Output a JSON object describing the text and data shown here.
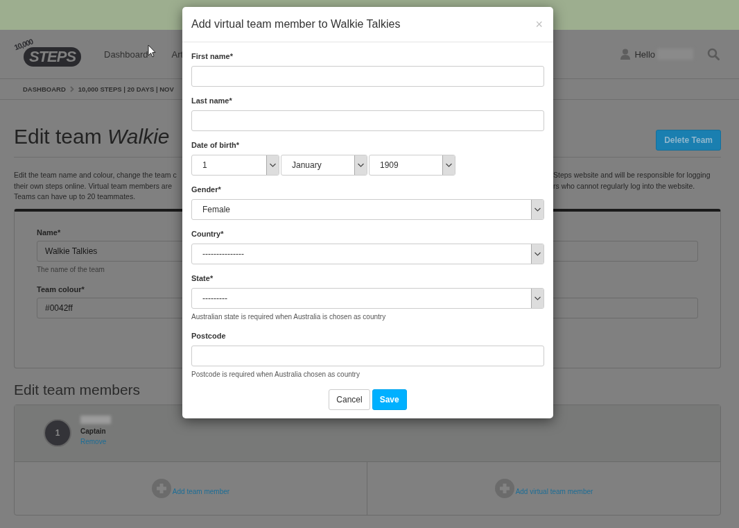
{
  "header": {
    "logo": {
      "number": "10,000",
      "word": "STEPS"
    },
    "nav": [
      {
        "label": "Dashboard"
      },
      {
        "label": "Art"
      }
    ],
    "greeting": "Hello"
  },
  "breadcrumb": [
    "DASHBOARD",
    "10,000 STEPS | 20 DAYS | NOV"
  ],
  "page": {
    "title": "Edit team *Walkie*",
    "delete_button": "Delete Team",
    "description": [
      {
        "left": "Edit the team name and colour, change the team c",
        "right": "Steps website and will be responsible for logging"
      },
      {
        "left": "their own steps online. Virtual team members are",
        "right": "rs who cannot regularly log into the website."
      },
      {
        "left": "Teams can have up to 20 teammates."
      }
    ]
  },
  "team_form": {
    "fields": [
      {
        "label": "Name*",
        "value": "Walkie Talkies",
        "help": "The name of the team"
      },
      {
        "label": "Team colour*",
        "value": "#0042ff"
      }
    ]
  },
  "members": {
    "heading": "Edit team members",
    "list": [
      {
        "number": "1",
        "role": "Captain",
        "action": "Remove"
      }
    ],
    "add_actions": [
      "Add team member",
      "Add virtual team member"
    ]
  },
  "modal": {
    "title": "Add virtual team member to Walkie Talkies",
    "close": "×",
    "fields": [
      {
        "kind": "text",
        "label": "First name*"
      },
      {
        "kind": "text",
        "label": "Last name*"
      },
      {
        "kind": "date",
        "label": "Date of birth*",
        "parts": [
          "1",
          "January",
          "1909"
        ]
      },
      {
        "kind": "select",
        "label": "Gender*",
        "value": "Female"
      },
      {
        "kind": "select",
        "label": "Country*",
        "value": "---------------"
      },
      {
        "kind": "select",
        "label": "State*",
        "value": "---------",
        "help": "Australian state is required when Australia is chosen as country"
      },
      {
        "kind": "text",
        "label": "Postcode",
        "help": "Postcode is required when Australia chosen as country"
      }
    ],
    "buttons": [
      {
        "label": "Cancel",
        "kind": "default"
      },
      {
        "label": "Save",
        "kind": "primary"
      }
    ]
  }
}
